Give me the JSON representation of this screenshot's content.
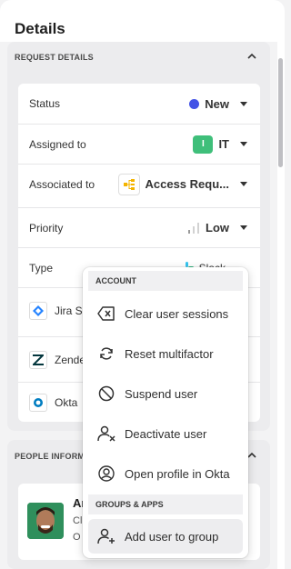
{
  "panel": {
    "title": "Details"
  },
  "request_section": {
    "header": "REQUEST DETAILS"
  },
  "fields": [
    {
      "label": "Status",
      "value": "New"
    },
    {
      "label": "Assigned to",
      "value": "IT",
      "badge": "I"
    },
    {
      "label": "Associated to",
      "value": "Access Requ..."
    },
    {
      "label": "Priority",
      "value": "Low"
    },
    {
      "label": "Type",
      "value": "Slack"
    }
  ],
  "integrations": [
    {
      "label": "Jira Se",
      "icon": "jira-icon"
    },
    {
      "label": "Zende",
      "icon": "zendesk-icon"
    },
    {
      "label": "Okta",
      "icon": "okta-icon"
    }
  ],
  "people_section": {
    "header": "PEOPLE INFORM"
  },
  "person": {
    "initials": "Ar",
    "line2": "Cl",
    "line3": "O"
  },
  "menu": {
    "account_heading": "ACCOUNT",
    "items": [
      {
        "label": "Clear user sessions",
        "icon": "clear-sessions-icon"
      },
      {
        "label": "Reset multifactor",
        "icon": "reset-icon"
      },
      {
        "label": "Suspend user",
        "icon": "suspend-icon"
      },
      {
        "label": "Deactivate user",
        "icon": "deactivate-user-icon"
      },
      {
        "label": "Open profile in Okta",
        "icon": "profile-icon"
      }
    ],
    "groups_heading": "GROUPS & APPS",
    "group_items": [
      {
        "label": "Add user to group",
        "icon": "add-user-icon"
      }
    ]
  },
  "colors": {
    "status_dot": "#4353e6",
    "it_badge": "#3fbf7a",
    "accent": "#2d8a5b"
  }
}
